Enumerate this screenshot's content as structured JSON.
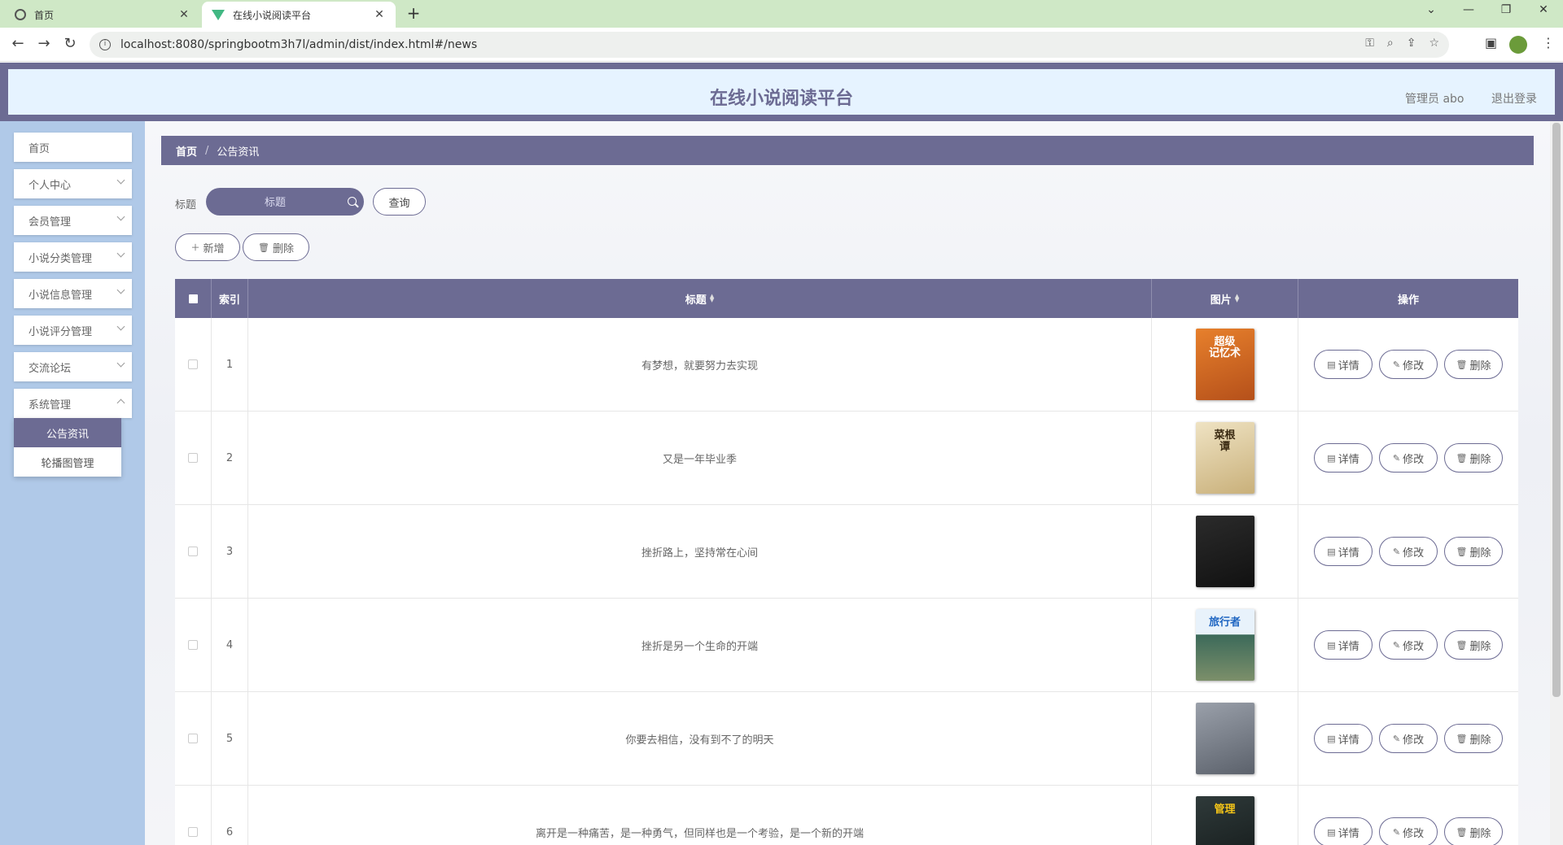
{
  "browser": {
    "tabs": [
      {
        "title": "首页"
      },
      {
        "title": "在线小说阅读平台"
      }
    ],
    "url": "localhost:8080/springbootm3h7l/admin/dist/index.html#/news"
  },
  "header": {
    "title": "在线小说阅读平台",
    "user": "管理员 abo",
    "logout": "退出登录"
  },
  "sidebar": {
    "items": [
      {
        "label": "首页"
      },
      {
        "label": "个人中心"
      },
      {
        "label": "会员管理"
      },
      {
        "label": "小说分类管理"
      },
      {
        "label": "小说信息管理"
      },
      {
        "label": "小说评分管理"
      },
      {
        "label": "交流论坛"
      },
      {
        "label": "系统管理"
      }
    ],
    "submenu": [
      {
        "label": "公告资讯"
      },
      {
        "label": "轮播图管理"
      }
    ]
  },
  "breadcrumb": {
    "home": "首页",
    "sep": "/",
    "current": "公告资讯"
  },
  "search": {
    "label": "标题",
    "placeholder": "标题",
    "query_label": "查询"
  },
  "toolbar": {
    "add_label": "新增",
    "delete_label": "删除"
  },
  "table": {
    "columns": {
      "index": "索引",
      "title": "标题",
      "image": "图片",
      "ops": "操作"
    },
    "row_buttons": {
      "detail": "详情",
      "edit": "修改",
      "delete": "删除"
    },
    "rows": [
      {
        "index": "1",
        "title": "有梦想，就要努力去实现",
        "cover_text": "超级\n记忆术"
      },
      {
        "index": "2",
        "title": "又是一年毕业季",
        "cover_text": "菜根\n谭"
      },
      {
        "index": "3",
        "title": "挫折路上，坚持常在心间",
        "cover_text": ""
      },
      {
        "index": "4",
        "title": "挫折是另一个生命的开端",
        "cover_text": "旅行者"
      },
      {
        "index": "5",
        "title": "你要去相信，没有到不了的明天",
        "cover_text": ""
      },
      {
        "index": "6",
        "title": "离开是一种痛苦，是一种勇气，但同样也是一个考验，是一个新的开端",
        "cover_text": "管理"
      }
    ]
  },
  "colors": {
    "accent": "#6c6b93",
    "sidebar": "#b0c9e8",
    "header_bg": "#e6f3ff"
  }
}
